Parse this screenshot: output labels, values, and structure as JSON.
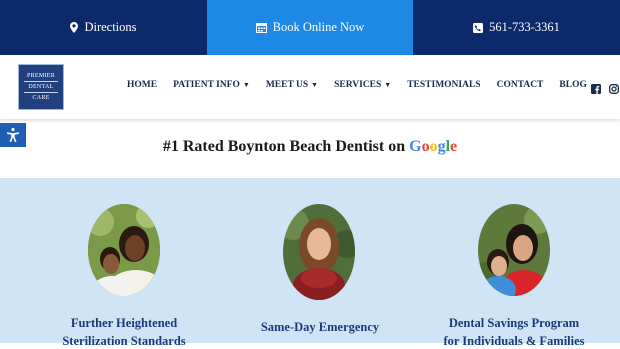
{
  "topbar": {
    "directions_label": "Directions",
    "book_label": "Book Online Now",
    "phone_label": "561-733-3361"
  },
  "logo": {
    "line1": "PREMIER",
    "line2": "DENTAL",
    "line3": "CARE"
  },
  "nav": {
    "home": "HOME",
    "patient_info": "PATIENT INFO",
    "meet_us": "MEET US",
    "services": "SERVICES",
    "testimonials": "TESTIMONIALS",
    "contact": "CONTACT",
    "blog": "BLOG"
  },
  "headline": {
    "prefix": "#1 Rated Boynton Beach Dentist on",
    "g1": "G",
    "g2": "o",
    "g3": "o",
    "g4": "g",
    "g5": "l",
    "g6": "e"
  },
  "features": [
    {
      "title1": "Further Heightened",
      "title2": "Sterilization Standards"
    },
    {
      "title1": "Same-Day Emergency"
    },
    {
      "title1": "Dental Savings Program",
      "title2": "for Individuals & Families"
    }
  ],
  "colors": {
    "navy": "#0c2a6b",
    "blue": "#1e88e5",
    "band": "#cfe5f6",
    "title": "#1a3a7a"
  }
}
